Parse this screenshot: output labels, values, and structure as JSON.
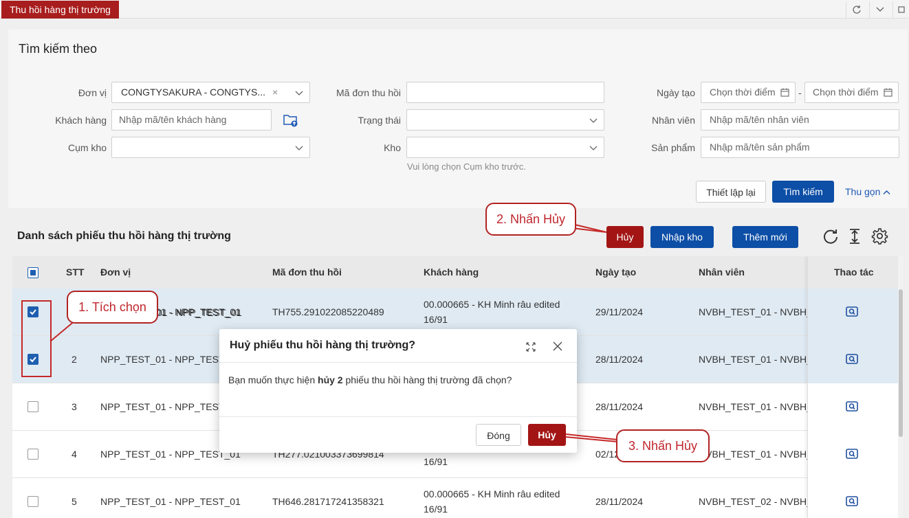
{
  "topbar": {
    "tab_label": "Thu hồi hàng thị trường"
  },
  "search": {
    "title": "Tìm kiếm theo",
    "don_vi": {
      "label": "Đơn vị",
      "value": "CONGTYSAKURA - CONGTYS..."
    },
    "khach_hang": {
      "label": "Khách hàng",
      "placeholder": "Nhập mã/tên khách hàng"
    },
    "cum_kho": {
      "label": "Cụm kho",
      "value": ""
    },
    "ma_don": {
      "label": "Mã đơn thu hồi",
      "value": ""
    },
    "trang_thai": {
      "label": "Trạng thái",
      "value": ""
    },
    "kho": {
      "label": "Kho",
      "value": "",
      "hint": "Vui lòng chọn Cụm kho trước."
    },
    "ngay_tao": {
      "label": "Ngày tạo",
      "from_placeholder": "Chọn thời điểm",
      "to_placeholder": "Chọn thời điểm",
      "separator": "-"
    },
    "nhan_vien": {
      "label": "Nhân viên",
      "placeholder": "Nhập mã/tên nhân viên"
    },
    "san_pham": {
      "label": "Sản phẩm",
      "placeholder": "Nhập mã/tên sản phẩm"
    },
    "reset_label": "Thiết lập lại",
    "search_label": "Tìm kiếm",
    "collapse_label": "Thu gọn"
  },
  "list": {
    "title": "Danh sách phiếu thu hồi hàng thị trường",
    "cancel_label": "Hủy",
    "import_label": "Nhập kho",
    "add_label": "Thêm mới"
  },
  "table": {
    "headers": {
      "stt": "STT",
      "don_vi": "Đơn vị",
      "ma_don": "Mã đơn thu hồi",
      "khach_hang": "Khách hàng",
      "ngay_tao": "Ngày tạo",
      "nhan_vien": "Nhân viên",
      "thao_tac": "Thao tác"
    },
    "rows": [
      {
        "stt": "1",
        "checked": true,
        "don_vi": "NPP_TEST_01 - NPP_TEST_01",
        "ma_don": "TH755.291022085220489",
        "kh1": "00.000665 - KH Minh râu edited",
        "kh2": "16/91",
        "ngay": "29/11/2024",
        "nv": "NVBH_TEST_01 - NVBH_"
      },
      {
        "stt": "2",
        "checked": true,
        "don_vi": "NPP_TEST_01 - NPP_TEST_01",
        "ma_don": "",
        "kh1": "",
        "kh2": "",
        "ngay": "28/11/2024",
        "nv": "NVBH_TEST_01 - NVBH_"
      },
      {
        "stt": "3",
        "checked": false,
        "don_vi": "NPP_TEST_01 - NPP_TEST_01",
        "ma_don": "",
        "kh1": "",
        "kh2": "",
        "ngay": "28/11/2024",
        "nv": "NVBH_TEST_01 - NVBH_"
      },
      {
        "stt": "4",
        "checked": false,
        "don_vi": "NPP_TEST_01 - NPP_TEST_01",
        "ma_don": "TH277.021003373699814",
        "kh1": "",
        "kh2": "16/91",
        "ngay": "02/12/2024",
        "nv": "NVBH_TEST_01 - NVBH_"
      },
      {
        "stt": "5",
        "checked": false,
        "don_vi": "NPP_TEST_01 - NPP_TEST_01",
        "ma_don": "TH646.281717241358321",
        "kh1": "00.000665 - KH Minh râu edited",
        "kh2": "16/91",
        "ngay": "28/11/2024",
        "nv": "NVBH_TEST_02 - NVBH_"
      }
    ]
  },
  "dialog": {
    "title": "Huỷ phiếu thu hồi hàng thị trường?",
    "body_pre": "Bạn muốn thực hiện ",
    "body_bold": "hủy 2",
    "body_post": " phiếu thu hồi hàng thị trường đã chọn?",
    "close_label": "Đóng",
    "confirm_label": "Hủy"
  },
  "annotations": {
    "step1": "1. Tích chọn",
    "step2": "2. Nhấn Hủy",
    "step3": "3. Nhấn Hủy"
  },
  "colors": {
    "brand_red": "#a31515",
    "brand_blue": "#0d4ea6",
    "selected_row": "#dfeaf3",
    "annotation": "#c62828"
  }
}
